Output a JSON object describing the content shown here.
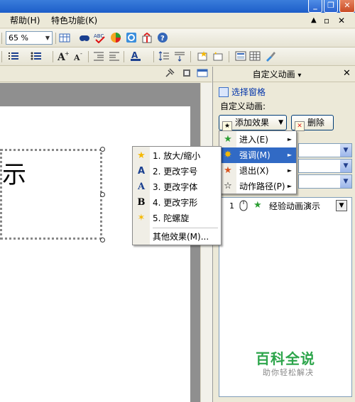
{
  "window": {
    "minimize_glyph": "_",
    "maximize_glyph": "❐",
    "close_glyph": "✕"
  },
  "menubar": {
    "items": [
      "帮助(H)",
      "特色功能(K)"
    ],
    "mdi_restore": "▲",
    "mdi_max": "▫",
    "mdi_close": "✕"
  },
  "toolbar": {
    "zoom_value": "65 %",
    "zoom_arrow": "▼"
  },
  "slide": {
    "text": "示"
  },
  "pane": {
    "title": "自定义动画",
    "title_arrow": "▾",
    "close": "✕",
    "selection_pane_link": "选择窗格",
    "custom_animation_label": "自定义动画:",
    "add_effect_button": "添加效果",
    "add_effect_arrow": "▼",
    "delete_button": "删除",
    "combo_arrow": "▼",
    "list_items": [
      {
        "number": "1",
        "name": "经验动画演示"
      }
    ]
  },
  "effects_menu": {
    "items": [
      {
        "label": "进入(E)",
        "icon": "green-star-icon"
      },
      {
        "label": "强调(M)",
        "icon": "yellow-star-icon",
        "highlighted": true
      },
      {
        "label": "退出(X)",
        "icon": "red-star-icon"
      },
      {
        "label": "动作路径(P)",
        "icon": "outline-star-icon"
      }
    ],
    "submenu_arrow": "►"
  },
  "emphasis_menu": {
    "items": [
      {
        "label": "1. 放大/缩小",
        "icon": "star-grow-icon"
      },
      {
        "label": "2. 更改字号",
        "icon": "font-size-icon"
      },
      {
        "label": "3. 更改字体",
        "icon": "font-icon"
      },
      {
        "label": "4. 更改字形",
        "icon": "bold-icon"
      },
      {
        "label": "5. 陀螺旋",
        "icon": "spin-star-icon"
      }
    ],
    "more": "其他效果(M)..."
  },
  "watermark": {
    "main": "百科全说",
    "sub": "助你轻松解决"
  },
  "colors": {
    "highlight": "#316ac5",
    "canvas_gray": "#8f8f8f",
    "watermark_green": "#2da54b"
  }
}
